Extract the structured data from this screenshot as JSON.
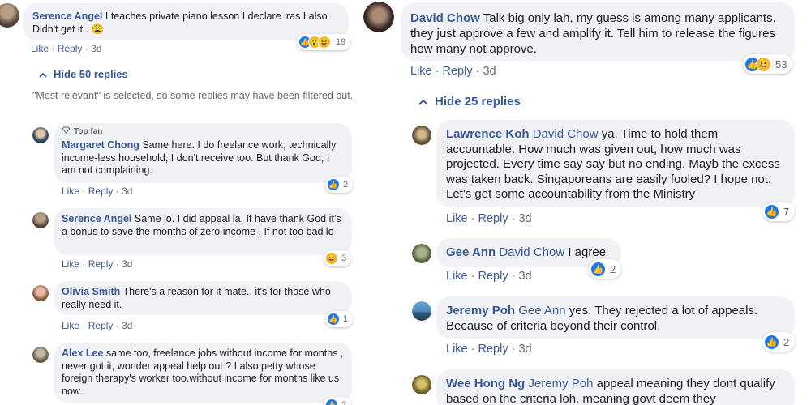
{
  "left": {
    "top_comment": {
      "author": "Serence Angel",
      "text": "I teaches private piano lesson I declare iras I also Didn't get it .",
      "emoji": "😩",
      "like": "Like",
      "reply": "Reply",
      "time": "3d",
      "reaction_count": "19"
    },
    "hide_replies": "Hide 50 replies",
    "filtered_note": "\"Most relevant\" is selected, so some replies may have been filtered out.",
    "top_fan_badge": "Top fan",
    "replies": [
      {
        "author": "Margaret Chong",
        "text": "Same here. I do freelance work, technically income-less household, I don't receive too. But thank God, I am not complaining.",
        "like": "Like",
        "reply": "Reply",
        "time": "3d",
        "reaction_count": "2"
      },
      {
        "author": "Serence Angel",
        "text": "Same lo. I did appeal la. If have thank God it's a bonus to save the months of zero income . If not too bad lo",
        "like": "Like",
        "reply": "Reply",
        "time": "3d",
        "reaction_count": "3"
      },
      {
        "author": "Olivia Smith",
        "text": "There's a reason for it mate.. it's for those who really need it.",
        "like": "Like",
        "reply": "Reply",
        "time": "3d",
        "reaction_count": "1"
      },
      {
        "author": "Alex Lee",
        "text": "same too, freelance jobs without income for months , never got it, wonder appeal help out ? I also petty whose foreign therapy's worker too.without income for months like us now.",
        "reaction_count": "2"
      }
    ]
  },
  "right": {
    "top_comment": {
      "author": "David Chow",
      "text": "Talk big only lah, my guess is among many applicants, they just approve a few and amplify it. Tell him to release the figures how many not approve.",
      "like": "Like",
      "reply": "Reply",
      "time": "3d",
      "reaction_count": "53"
    },
    "hide_replies": "Hide 25 replies",
    "replies": [
      {
        "author": "Lawrence Koh",
        "mention": "David Chow",
        "text": "ya. Time to hold them accountable. How much was given out, how much was projected. Every time say say but no ending. Mayb the excess was taken back. Singaporeans are easily fooled? I hope not. Let's get some accountability from the Ministry",
        "like": "Like",
        "reply": "Reply",
        "time": "3d",
        "reaction_count": "7"
      },
      {
        "author": "Gee Ann",
        "mention": "David Chow",
        "text": "I agree",
        "like": "Like",
        "reply": "Reply",
        "time": "3d",
        "reaction_count": "2"
      },
      {
        "author": "Jeremy Poh",
        "mention": "Gee Ann",
        "text": "yes. They rejected a lot of appeals. Because of criteria beyond their control.",
        "like": "Like",
        "reply": "Reply",
        "time": "3d",
        "reaction_count": "2"
      },
      {
        "author": "Wee Hong Ng",
        "mention": "Jeremy Poh",
        "text": "appeal meaning they dont qualify based on the criteria loh. meaning govt deem they"
      }
    ]
  },
  "colors": {
    "link": "#385898",
    "bubble": "#f0f2f5",
    "meta": "#65676b",
    "like": "#1877f2",
    "haha": "#f7b928"
  }
}
